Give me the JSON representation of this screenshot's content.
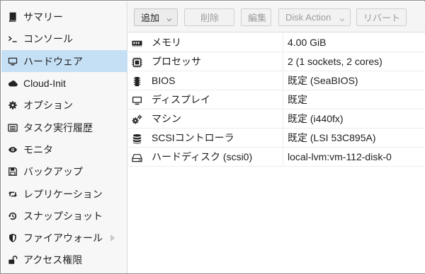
{
  "sidebar": {
    "items": [
      {
        "label": "サマリー",
        "icon": "book-icon",
        "active": false
      },
      {
        "label": "コンソール",
        "icon": "terminal-icon",
        "active": false
      },
      {
        "label": "ハードウェア",
        "icon": "monitor-icon",
        "active": true
      },
      {
        "label": "Cloud-Init",
        "icon": "cloud-icon",
        "active": false
      },
      {
        "label": "オプション",
        "icon": "gear-icon",
        "active": false
      },
      {
        "label": "タスク実行履歴",
        "icon": "list-icon",
        "active": false
      },
      {
        "label": "モニタ",
        "icon": "eye-icon",
        "active": false
      },
      {
        "label": "バックアップ",
        "icon": "floppy-icon",
        "active": false
      },
      {
        "label": "レプリケーション",
        "icon": "retweet-icon",
        "active": false
      },
      {
        "label": "スナップショット",
        "icon": "history-icon",
        "active": false
      },
      {
        "label": "ファイアウォール",
        "icon": "shield-icon",
        "active": false,
        "has_submenu": true
      },
      {
        "label": "アクセス権限",
        "icon": "unlock-icon",
        "active": false
      }
    ]
  },
  "toolbar": {
    "add_label": "追加",
    "remove_label": "削除",
    "edit_label": "編集",
    "disk_action_label": "Disk Action",
    "revert_label": "リバート"
  },
  "hardware": {
    "rows": [
      {
        "name": "メモリ",
        "value": "4.00 GiB",
        "icon": "memory-icon"
      },
      {
        "name": "プロセッサ",
        "value": "2 (1 sockets, 2 cores)",
        "icon": "cpu-icon"
      },
      {
        "name": "BIOS",
        "value": "既定 (SeaBIOS)",
        "icon": "microchip-icon"
      },
      {
        "name": "ディスプレイ",
        "value": "既定",
        "icon": "desktop-icon"
      },
      {
        "name": "マシン",
        "value": "既定 (i440fx)",
        "icon": "cogs-icon"
      },
      {
        "name": "SCSIコントローラ",
        "value": "既定 (LSI 53C895A)",
        "icon": "database-icon"
      },
      {
        "name": "ハードディスク (scsi0)",
        "value": "local-lvm:vm-112-disk-0",
        "icon": "hdd-icon"
      }
    ]
  },
  "colors": {
    "active_bg": "#c5dff5",
    "sidebar_bg": "#f7f7f7",
    "toolbar_bg": "#f5f5f5"
  }
}
